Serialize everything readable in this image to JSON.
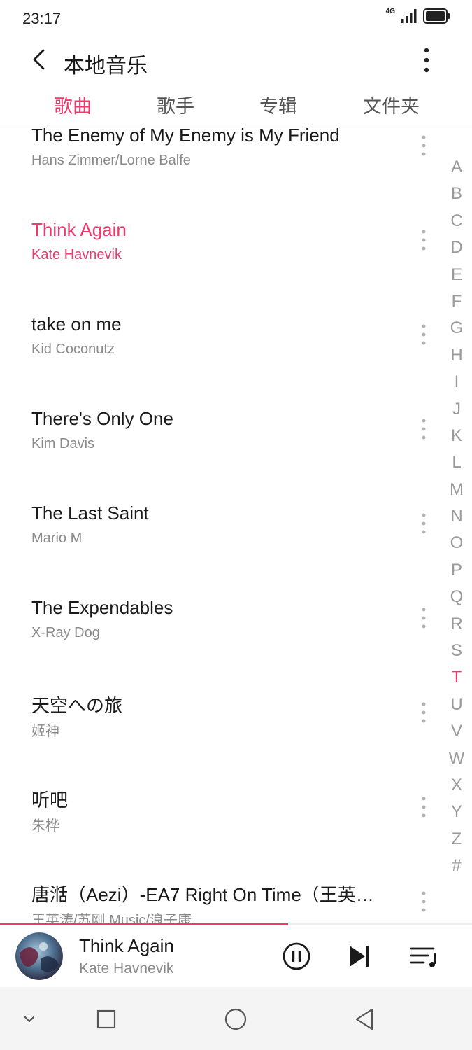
{
  "status_bar": {
    "time": "23:17",
    "network": "4G",
    "icons": [
      "signal-icon",
      "battery-icon"
    ]
  },
  "header": {
    "title": "本地音乐",
    "back_icon": "back-arrow-icon",
    "more_icon": "more-vertical-icon"
  },
  "tabs": [
    {
      "label": "歌曲",
      "active": true
    },
    {
      "label": "歌手",
      "active": false
    },
    {
      "label": "专辑",
      "active": false
    },
    {
      "label": "文件夹",
      "active": false
    }
  ],
  "songs": [
    {
      "title": "The Enemy of My Enemy is My Friend",
      "artist": "Hans Zimmer/Lorne Balfe",
      "playing": false
    },
    {
      "title": "Think Again",
      "artist": "Kate Havnevik",
      "playing": true
    },
    {
      "title": "take on me",
      "artist": "Kid Coconutz",
      "playing": false
    },
    {
      "title": "There's Only One",
      "artist": "Kim Davis",
      "playing": false
    },
    {
      "title": "The Last Saint",
      "artist": "Mario M",
      "playing": false
    },
    {
      "title": "The Expendables",
      "artist": "X-Ray Dog",
      "playing": false
    },
    {
      "title": "天空への旅",
      "artist": "姬神",
      "playing": false
    },
    {
      "title": "听吧",
      "artist": "朱桦",
      "playing": false
    },
    {
      "title": "唐湉（Aezi）-EA7 Right On Time（王英…",
      "artist": "王英涛/苏刚.Music/浪子康",
      "playing": false
    }
  ],
  "index_letters": [
    "A",
    "B",
    "C",
    "D",
    "E",
    "F",
    "G",
    "H",
    "I",
    "J",
    "K",
    "L",
    "M",
    "N",
    "O",
    "P",
    "Q",
    "R",
    "S",
    "T",
    "U",
    "V",
    "W",
    "X",
    "Y",
    "Z",
    "#"
  ],
  "index_active": "T",
  "now_playing": {
    "title": "Think Again",
    "artist": "Kate Havnevik",
    "progress": 0.61,
    "controls": [
      "pause-icon",
      "skip-next-icon",
      "playlist-icon"
    ]
  },
  "nav_bar": [
    "collapse-icon",
    "recent-apps-icon",
    "home-icon",
    "back-icon"
  ],
  "colors": {
    "accent": "#f0386b",
    "text": "#1a1a1a",
    "secondary": "#8a8a8a"
  }
}
